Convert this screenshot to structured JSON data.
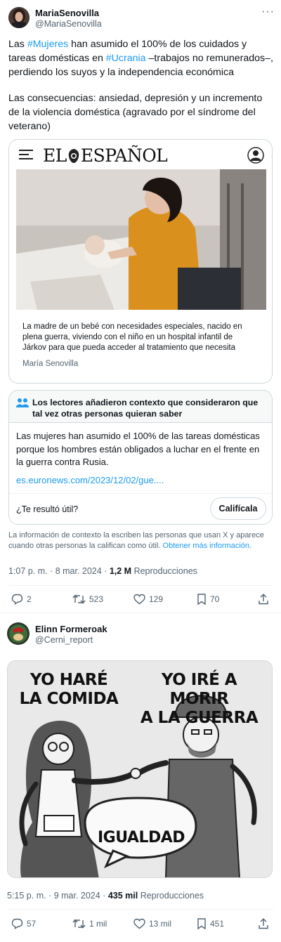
{
  "tweet1": {
    "display_name": "MariaSenovilla",
    "handle": "@MariaSenovilla",
    "text_p1_a": "Las ",
    "hashtag1": "#Mujeres",
    "text_p1_b": " han asumido el 100% de los cuidados y tareas domésticas en ",
    "hashtag2": "#Ucrania",
    "text_p1_c": " –trabajos no remunerados–, perdiendo los suyos y la independencia económica",
    "text_p2": "Las consecuencias: ansiedad, depresión y un incremento de la violencia doméstica (agravado por el síndrome del veterano)",
    "card": {
      "logo_left": "EL",
      "logo_right": "ESPAÑOL",
      "caption": "La madre de un bebé con necesidades especiales, nacido en plena guerra, viviendo con el niño en un hospital infantil de Járkov para que pueda acceder al tratamiento que necesita",
      "credit": "María Senovilla"
    },
    "community_note": {
      "title": "Los lectores añadieron contexto que consideraron que tal vez otras personas quieran saber",
      "body": "Las mujeres han asumido el 100% de las tareas domésticas porque los hombres están obligados a luchar en el frente en la guerra contra Rusia.",
      "link": "es.euronews.com/2023/12/02/gue....",
      "question": "¿Te resultó útil?",
      "rate_button": "Califícala"
    },
    "note_info": "La información de contexto la escriben las personas que usan X y aparece cuando otras personas la califican como útil.",
    "note_info_link": "Obtener más información.",
    "time": "1:07 p. m. · 8 mar. 2024 · ",
    "views": "1,2 M",
    "views_label": " Reproducciones",
    "actions": {
      "replies": "2",
      "reposts": "523",
      "likes": "129",
      "bookmarks": "70"
    }
  },
  "tweet2": {
    "display_name": "Elinn Formeroak",
    "handle": "@Cerni_report",
    "poster": {
      "left_line1": "YO HARÉ",
      "left_line2": "LA COMIDA",
      "right_line1": "YO IRÉ A MORIR",
      "right_line2": "A LA GUERRA",
      "bubble": "IGUALDAD"
    },
    "time": "5:15 p. m. · 9 mar. 2024 · ",
    "views": "435 mil",
    "views_label": " Reproducciones",
    "actions": {
      "replies": "57",
      "reposts": "1 mil",
      "likes": "13 mil",
      "bookmarks": "451"
    }
  },
  "colors": {
    "accent": "#1d9bf0",
    "text": "#0f1419",
    "muted": "#536471",
    "border": "#cfd9de"
  }
}
